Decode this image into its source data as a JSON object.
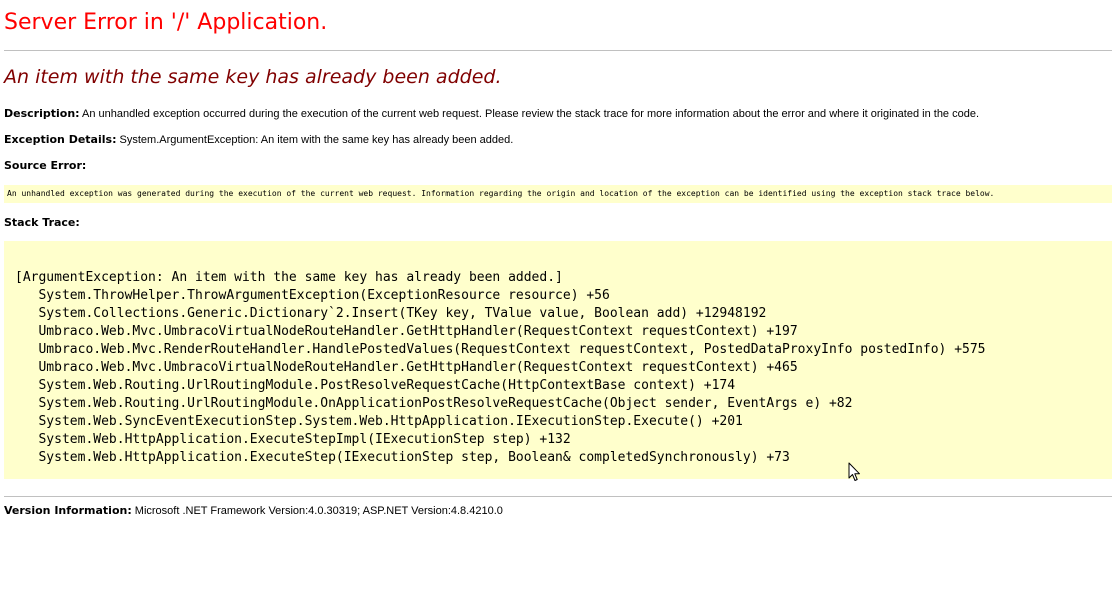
{
  "page": {
    "title": "Server Error in '/' Application.",
    "subtitle": "An item with the same key has already been added.",
    "description": {
      "label": "Description:",
      "text": " An unhandled exception occurred during the execution of the current web request. Please review the stack trace for more information about the error and where it originated in the code."
    },
    "exception_details": {
      "label": "Exception Details:",
      "text": " System.ArgumentException: An item with the same key has already been added."
    },
    "source_error": {
      "label": "Source Error:",
      "note": "An unhandled exception was generated during the execution of the current web request. Information regarding the origin and location of the exception can be identified using the exception stack trace below."
    },
    "stack_trace": {
      "label": "Stack Trace:",
      "lines": [
        "[ArgumentException: An item with the same key has already been added.]",
        "   System.ThrowHelper.ThrowArgumentException(ExceptionResource resource) +56",
        "   System.Collections.Generic.Dictionary`2.Insert(TKey key, TValue value, Boolean add) +12948192",
        "   Umbraco.Web.Mvc.UmbracoVirtualNodeRouteHandler.GetHttpHandler(RequestContext requestContext) +197",
        "   Umbraco.Web.Mvc.RenderRouteHandler.HandlePostedValues(RequestContext requestContext, PostedDataProxyInfo postedInfo) +575",
        "   Umbraco.Web.Mvc.UmbracoVirtualNodeRouteHandler.GetHttpHandler(RequestContext requestContext) +465",
        "   System.Web.Routing.UrlRoutingModule.PostResolveRequestCache(HttpContextBase context) +174",
        "   System.Web.Routing.UrlRoutingModule.OnApplicationPostResolveRequestCache(Object sender, EventArgs e) +82",
        "   System.Web.SyncEventExecutionStep.System.Web.HttpApplication.IExecutionStep.Execute() +201",
        "   System.Web.HttpApplication.ExecuteStepImpl(IExecutionStep step) +132",
        "   System.Web.HttpApplication.ExecuteStep(IExecutionStep step, Boolean& completedSynchronously) +73"
      ]
    },
    "version": {
      "label": "Version Information:",
      "text": " Microsoft .NET Framework Version:4.0.30319; ASP.NET Version:4.8.4210.0"
    },
    "colors": {
      "title": "#ff0000",
      "subtitle": "#800000",
      "code_background": "#ffffcc"
    },
    "cursor_icon": "mouse-pointer-icon"
  }
}
